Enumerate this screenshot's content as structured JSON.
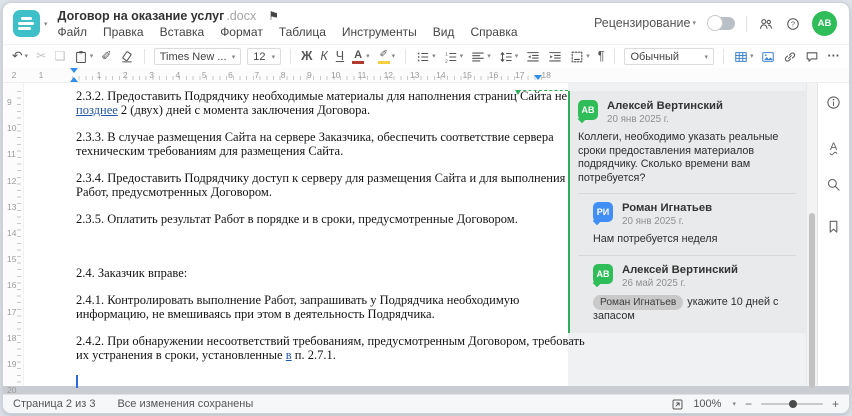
{
  "header": {
    "title": "Договор на оказание услуг",
    "title_extension": ".docx",
    "menus": [
      "Файл",
      "Правка",
      "Вставка",
      "Формат",
      "Таблица",
      "Инструменты",
      "Вид",
      "Справка"
    ],
    "review_mode_label": "Рецензирование",
    "avatar_initials": "АВ"
  },
  "icons": {
    "undo": "↶",
    "cut": "✂",
    "copy": "❏",
    "format_painter": "✐",
    "highlight_pen": "✐",
    "flag": "⚑",
    "caret": "▾",
    "pilcrow": "¶",
    "more": "···"
  },
  "toolbar": {
    "font_name": "Times New ...",
    "font_size": "12",
    "bold_label": "Ж",
    "italic_label": "К",
    "underline_label": "Ч",
    "font_color_label": "А",
    "style_name": "Обычный",
    "font_color_swatch": "#b03a2e",
    "highlight_swatch": "#f4d03f"
  },
  "ruler": {
    "h_left_numbers": [
      "2",
      "1"
    ],
    "h_numbers": [
      "1",
      "2",
      "3",
      "4",
      "5",
      "6",
      "7",
      "8",
      "9",
      "10",
      "11",
      "12",
      "13",
      "14",
      "15",
      "16",
      "17",
      "18"
    ],
    "v_numbers": [
      "9",
      "10",
      "11",
      "12",
      "13",
      "14",
      "15",
      "16",
      "17",
      "18",
      "19",
      "20"
    ]
  },
  "document": {
    "paragraphs": [
      {
        "lines": [
          [
            {
              "t": "2.3.2. Предоставить Подрядчику необходимые материалы для наполнения страниц Сайта не"
            }
          ],
          [
            {
              "t": "позднее",
              "ins": true
            },
            {
              "t": " 2 (двух) дней с момента заключения Договора."
            }
          ]
        ]
      },
      {
        "lines": [
          [
            {
              "t": "2.3.3. В случае размещения Сайта на сервере Заказчика, обеспечить соответствие сервера"
            }
          ],
          [
            {
              "t": "техническим требованиям для размещения Сайта."
            }
          ]
        ]
      },
      {
        "lines": [
          [
            {
              "t": "2.3.4. Предоставить Подрядчику доступ к серверу для размещения Сайта и для выполнения"
            }
          ],
          [
            {
              "t": "Работ, предусмотренных Договором."
            }
          ]
        ]
      },
      {
        "lines": [
          [
            {
              "t": "2.3.5. Оплатить результат Работ в порядке и в сроки, предусмотренные Договором."
            }
          ]
        ]
      },
      {
        "lines": []
      },
      {
        "lines": [
          [
            {
              "t": "2.4. Заказчик вправе:"
            }
          ]
        ]
      },
      {
        "lines": [
          [
            {
              "t": "2.4.1. Контролировать выполнение Работ, запрашивать у Подрядчика необходимую"
            }
          ],
          [
            {
              "t": "информацию, не вмешиваясь при этом в деятельность Подрядчика."
            }
          ]
        ]
      },
      {
        "lines": [
          [
            {
              "t": "2.4.2. При обнаружении несоответствий требованиям, предусмотренным Договором, требовать"
            }
          ],
          [
            {
              "t": "их устранения в сроки, установленные "
            },
            {
              "t": "в",
              "ins": true
            },
            {
              "t": " п. 2.7.1."
            }
          ]
        ]
      }
    ]
  },
  "comments": {
    "accent_color": "#2fae58",
    "thread": [
      {
        "initials": "АВ",
        "avatar_color": "#2ebd59",
        "name": "Алексей Вертинский",
        "date": "20 янв 2025 г.",
        "text": "Коллеги, необходимо указать реальные сроки предоставления материалов подрядчику. Сколько времени вам потребуется?",
        "is_reply": false
      },
      {
        "initials": "РИ",
        "avatar_color": "#418ef4",
        "name": "Роман Игнатьев",
        "date": "20 янв 2025 г.",
        "text": "Нам потребуется неделя",
        "is_reply": true
      },
      {
        "initials": "АВ",
        "avatar_color": "#2ebd59",
        "name": "Алексей Вертинский",
        "date": "26 май 2025 г.",
        "mention": "Роман Игнатьев",
        "text": "укажите 10 дней с запасом",
        "is_reply": true
      }
    ]
  },
  "statusbar": {
    "page_label": "Страница 2 из 3",
    "save_status": "Все изменения сохранены",
    "zoom_value": "100%",
    "zoom_out": "−",
    "zoom_in": "+"
  }
}
